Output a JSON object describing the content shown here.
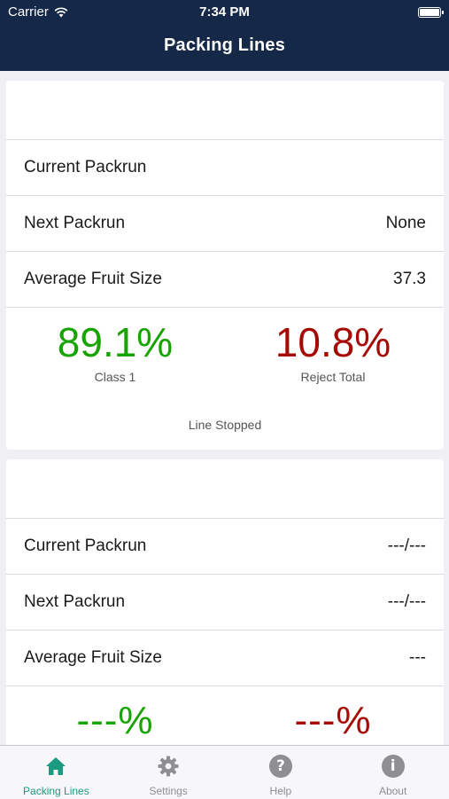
{
  "status_bar": {
    "carrier": "Carrier",
    "time": "7:34 PM"
  },
  "nav": {
    "title": "Packing Lines"
  },
  "lines": [
    {
      "current_packrun_label": "Current Packrun",
      "current_packrun_value": "",
      "next_packrun_label": "Next Packrun",
      "next_packrun_value": "None",
      "avg_fruit_size_label": "Average Fruit Size",
      "avg_fruit_size_value": "37.3",
      "class1_value": "89.1%",
      "class1_label": "Class 1",
      "reject_value": "10.8%",
      "reject_label": "Reject Total",
      "status": "Line Stopped"
    },
    {
      "current_packrun_label": "Current Packrun",
      "current_packrun_value": "---/---",
      "next_packrun_label": "Next Packrun",
      "next_packrun_value": "---/---",
      "avg_fruit_size_label": "Average Fruit Size",
      "avg_fruit_size_value": "---",
      "class1_value": "---%",
      "reject_value": "---%"
    }
  ],
  "tabs": [
    {
      "label": "Packing Lines",
      "icon": "home-icon",
      "active": true
    },
    {
      "label": "Settings",
      "icon": "gear-icon",
      "active": false
    },
    {
      "label": "Help",
      "icon": "question-icon",
      "active": false
    },
    {
      "label": "About",
      "icon": "info-icon",
      "active": false
    }
  ],
  "colors": {
    "nav_background": "#152847",
    "class1_green": "#17a300",
    "reject_red": "#a50a05",
    "active_tab": "#1b9a80"
  }
}
